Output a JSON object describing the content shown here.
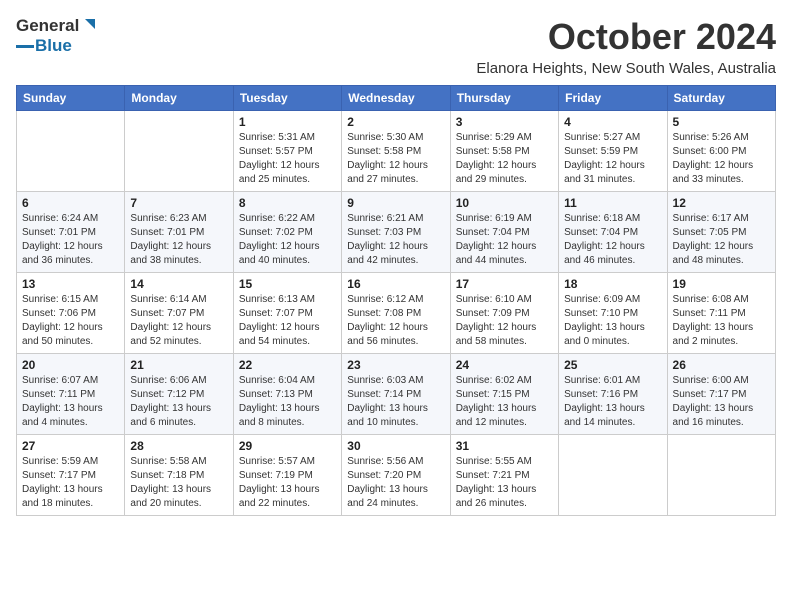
{
  "logo": {
    "general": "General",
    "blue": "Blue"
  },
  "title": "October 2024",
  "location": "Elanora Heights, New South Wales, Australia",
  "headers": [
    "Sunday",
    "Monday",
    "Tuesday",
    "Wednesday",
    "Thursday",
    "Friday",
    "Saturday"
  ],
  "weeks": [
    [
      {
        "day": "",
        "info": ""
      },
      {
        "day": "",
        "info": ""
      },
      {
        "day": "1",
        "info": "Sunrise: 5:31 AM\nSunset: 5:57 PM\nDaylight: 12 hours\nand 25 minutes."
      },
      {
        "day": "2",
        "info": "Sunrise: 5:30 AM\nSunset: 5:58 PM\nDaylight: 12 hours\nand 27 minutes."
      },
      {
        "day": "3",
        "info": "Sunrise: 5:29 AM\nSunset: 5:58 PM\nDaylight: 12 hours\nand 29 minutes."
      },
      {
        "day": "4",
        "info": "Sunrise: 5:27 AM\nSunset: 5:59 PM\nDaylight: 12 hours\nand 31 minutes."
      },
      {
        "day": "5",
        "info": "Sunrise: 5:26 AM\nSunset: 6:00 PM\nDaylight: 12 hours\nand 33 minutes."
      }
    ],
    [
      {
        "day": "6",
        "info": "Sunrise: 6:24 AM\nSunset: 7:01 PM\nDaylight: 12 hours\nand 36 minutes."
      },
      {
        "day": "7",
        "info": "Sunrise: 6:23 AM\nSunset: 7:01 PM\nDaylight: 12 hours\nand 38 minutes."
      },
      {
        "day": "8",
        "info": "Sunrise: 6:22 AM\nSunset: 7:02 PM\nDaylight: 12 hours\nand 40 minutes."
      },
      {
        "day": "9",
        "info": "Sunrise: 6:21 AM\nSunset: 7:03 PM\nDaylight: 12 hours\nand 42 minutes."
      },
      {
        "day": "10",
        "info": "Sunrise: 6:19 AM\nSunset: 7:04 PM\nDaylight: 12 hours\nand 44 minutes."
      },
      {
        "day": "11",
        "info": "Sunrise: 6:18 AM\nSunset: 7:04 PM\nDaylight: 12 hours\nand 46 minutes."
      },
      {
        "day": "12",
        "info": "Sunrise: 6:17 AM\nSunset: 7:05 PM\nDaylight: 12 hours\nand 48 minutes."
      }
    ],
    [
      {
        "day": "13",
        "info": "Sunrise: 6:15 AM\nSunset: 7:06 PM\nDaylight: 12 hours\nand 50 minutes."
      },
      {
        "day": "14",
        "info": "Sunrise: 6:14 AM\nSunset: 7:07 PM\nDaylight: 12 hours\nand 52 minutes."
      },
      {
        "day": "15",
        "info": "Sunrise: 6:13 AM\nSunset: 7:07 PM\nDaylight: 12 hours\nand 54 minutes."
      },
      {
        "day": "16",
        "info": "Sunrise: 6:12 AM\nSunset: 7:08 PM\nDaylight: 12 hours\nand 56 minutes."
      },
      {
        "day": "17",
        "info": "Sunrise: 6:10 AM\nSunset: 7:09 PM\nDaylight: 12 hours\nand 58 minutes."
      },
      {
        "day": "18",
        "info": "Sunrise: 6:09 AM\nSunset: 7:10 PM\nDaylight: 13 hours\nand 0 minutes."
      },
      {
        "day": "19",
        "info": "Sunrise: 6:08 AM\nSunset: 7:11 PM\nDaylight: 13 hours\nand 2 minutes."
      }
    ],
    [
      {
        "day": "20",
        "info": "Sunrise: 6:07 AM\nSunset: 7:11 PM\nDaylight: 13 hours\nand 4 minutes."
      },
      {
        "day": "21",
        "info": "Sunrise: 6:06 AM\nSunset: 7:12 PM\nDaylight: 13 hours\nand 6 minutes."
      },
      {
        "day": "22",
        "info": "Sunrise: 6:04 AM\nSunset: 7:13 PM\nDaylight: 13 hours\nand 8 minutes."
      },
      {
        "day": "23",
        "info": "Sunrise: 6:03 AM\nSunset: 7:14 PM\nDaylight: 13 hours\nand 10 minutes."
      },
      {
        "day": "24",
        "info": "Sunrise: 6:02 AM\nSunset: 7:15 PM\nDaylight: 13 hours\nand 12 minutes."
      },
      {
        "day": "25",
        "info": "Sunrise: 6:01 AM\nSunset: 7:16 PM\nDaylight: 13 hours\nand 14 minutes."
      },
      {
        "day": "26",
        "info": "Sunrise: 6:00 AM\nSunset: 7:17 PM\nDaylight: 13 hours\nand 16 minutes."
      }
    ],
    [
      {
        "day": "27",
        "info": "Sunrise: 5:59 AM\nSunset: 7:17 PM\nDaylight: 13 hours\nand 18 minutes."
      },
      {
        "day": "28",
        "info": "Sunrise: 5:58 AM\nSunset: 7:18 PM\nDaylight: 13 hours\nand 20 minutes."
      },
      {
        "day": "29",
        "info": "Sunrise: 5:57 AM\nSunset: 7:19 PM\nDaylight: 13 hours\nand 22 minutes."
      },
      {
        "day": "30",
        "info": "Sunrise: 5:56 AM\nSunset: 7:20 PM\nDaylight: 13 hours\nand 24 minutes."
      },
      {
        "day": "31",
        "info": "Sunrise: 5:55 AM\nSunset: 7:21 PM\nDaylight: 13 hours\nand 26 minutes."
      },
      {
        "day": "",
        "info": ""
      },
      {
        "day": "",
        "info": ""
      }
    ]
  ]
}
